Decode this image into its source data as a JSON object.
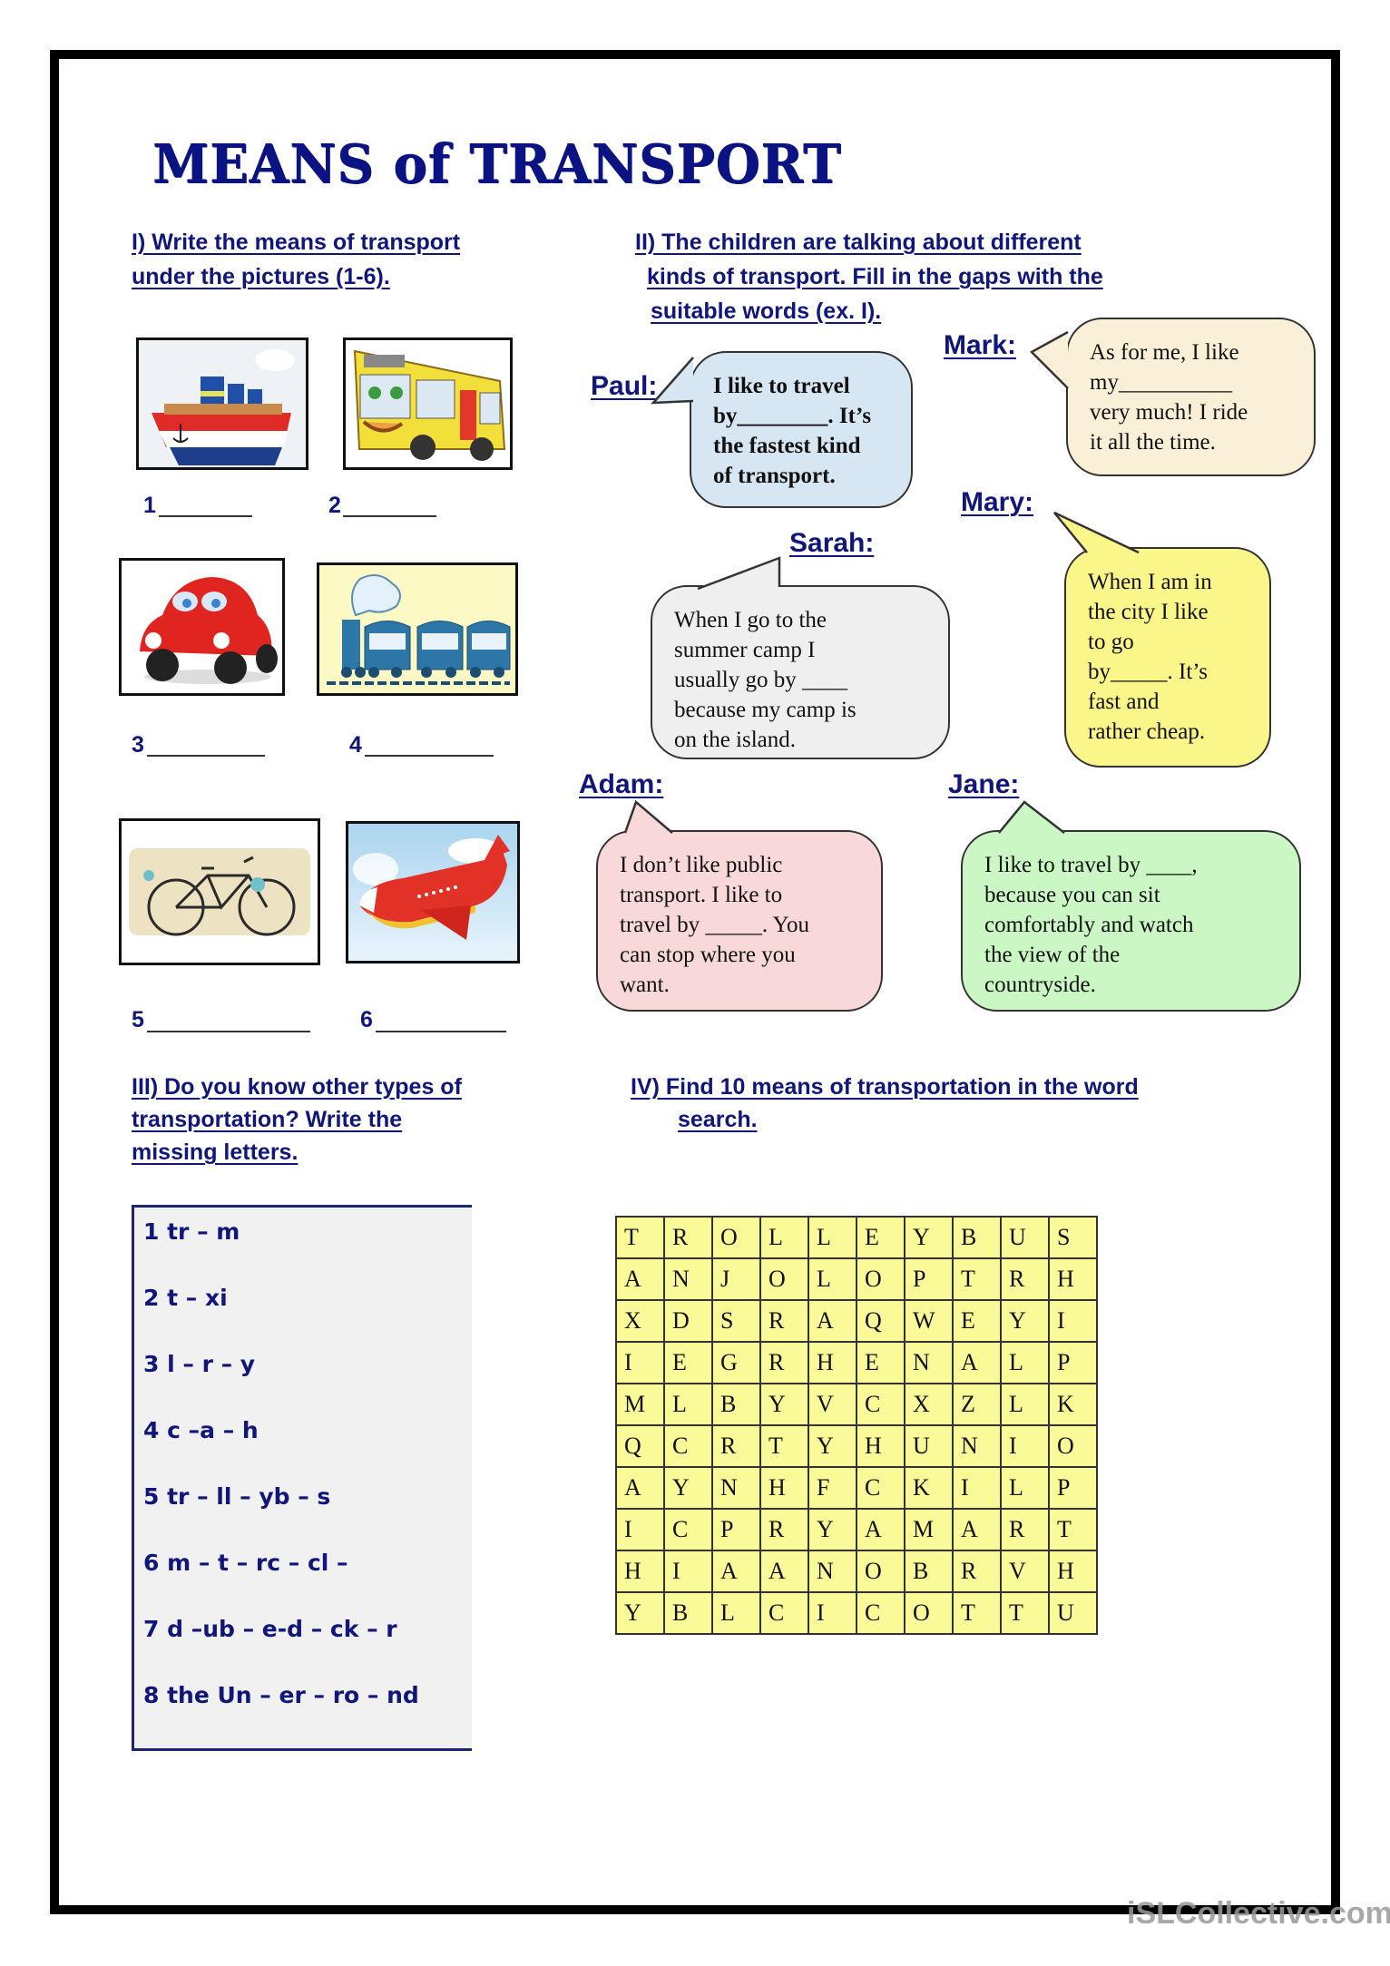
{
  "title": "MEANS of TRANSPORT",
  "section1": {
    "heading_lines": [
      "I) Write the means of transport",
      "under the pictures (1-6)."
    ],
    "pictures": [
      {
        "number": "1",
        "icon": "ship-icon"
      },
      {
        "number": "2",
        "icon": "bus-icon"
      },
      {
        "number": "3",
        "icon": "car-icon"
      },
      {
        "number": "4",
        "icon": "train-icon"
      },
      {
        "number": "5",
        "icon": "bicycle-icon"
      },
      {
        "number": "6",
        "icon": "airplane-icon"
      }
    ]
  },
  "section2": {
    "heading_lines": [
      "II) The children are talking about different",
      "kinds of transport. Fill in the gaps with the",
      "suitable words (ex. I)."
    ],
    "speakers": [
      {
        "name": "Paul:",
        "lines": [
          "I like to travel",
          "by________. It’s",
          "the fastest kind",
          "of transport."
        ],
        "color": "#d6e6f3"
      },
      {
        "name": "Mark:",
        "lines": [
          "As for me, I like",
          "my__________",
          "very much! I ride",
          "it all the time."
        ],
        "color": "#faf0d8"
      },
      {
        "name": "Sarah:",
        "lines": [
          "When I go to the",
          "summer camp I",
          "usually go by ____",
          "because my camp is",
          "on the island."
        ],
        "color": "#efefef"
      },
      {
        "name": "Mary:",
        "lines": [
          "When I am in",
          "the city I like",
          "to go",
          "by_____. It’s",
          "fast and",
          "rather cheap."
        ],
        "color": "#fbf68a"
      },
      {
        "name": "Adam:",
        "lines": [
          "I don’t like public",
          "transport. I like to",
          "travel by _____.  You",
          "can stop where you",
          "want."
        ],
        "color": "#f8d8d8"
      },
      {
        "name": "Jane:",
        "lines": [
          "I like to travel by ____,",
          "because you can sit",
          "comfortably and watch",
          "the view of the",
          "countryside."
        ],
        "color": "#caf7c4"
      }
    ]
  },
  "section3": {
    "heading_lines": [
      "III) Do you know other types of",
      "transportation? Write the",
      "missing letters."
    ],
    "items": [
      "1  tr – m",
      "2  t – xi",
      "3  l – r – y",
      "4  c –a – h",
      "5  tr – ll – yb – s",
      "6  m – t – rc – cl –",
      "7  d –ub – e-d – ck – r",
      "8  the Un – er – ro – nd"
    ]
  },
  "section4": {
    "heading_lines": [
      "IV) Find 10 means of transportation in the word",
      "search."
    ],
    "grid": [
      [
        "T",
        "R",
        "O",
        "L",
        "L",
        "E",
        "Y",
        "B",
        "U",
        "S"
      ],
      [
        "A",
        "N",
        "J",
        "O",
        "L",
        "O",
        "P",
        "T",
        "R",
        "H"
      ],
      [
        "X",
        "D",
        "S",
        "R",
        "A",
        "Q",
        "W",
        "E",
        "Y",
        "I"
      ],
      [
        "I",
        "E",
        "G",
        "R",
        "H",
        "E",
        "N",
        "A",
        "L",
        "P"
      ],
      [
        "M",
        "L",
        "B",
        "Y",
        "V",
        "C",
        "X",
        "Z",
        "L",
        "K"
      ],
      [
        "Q",
        "C",
        "R",
        "T",
        "Y",
        "H",
        "U",
        "N",
        "I",
        "O"
      ],
      [
        "A",
        "Y",
        "N",
        "H",
        "F",
        "C",
        "K",
        "I",
        "L",
        "P"
      ],
      [
        "I",
        "C",
        "P",
        "R",
        "Y",
        "A",
        "M",
        "A",
        "R",
        "T"
      ],
      [
        "H",
        "I",
        "A",
        "A",
        "N",
        "O",
        "B",
        "R",
        "V",
        "H"
      ],
      [
        "Y",
        "B",
        "L",
        "C",
        "I",
        "C",
        "O",
        "T",
        "T",
        "U"
      ]
    ]
  },
  "watermark": "iSLCollective.com",
  "colors": {
    "heading": "#10167a",
    "grid_fill": "#fafa98",
    "frame": "#000000"
  }
}
